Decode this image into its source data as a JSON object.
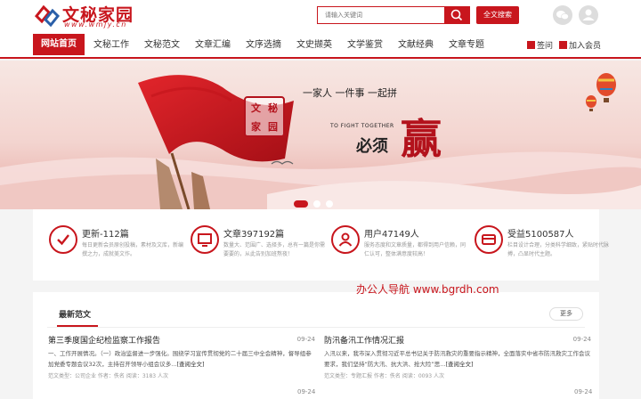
{
  "logo": {
    "title": "文秘家园",
    "subtitle": "www.wmjy.cn"
  },
  "search": {
    "placeholder": "请输入关键词",
    "full_label": "全文搜索"
  },
  "nav": {
    "home": "网站首页",
    "items": [
      "文秘工作",
      "文秘范文",
      "文章汇编",
      "文序选摘",
      "文史撷英",
      "文学鉴赏",
      "文献经典",
      "文章专题"
    ],
    "sign_in": "签问",
    "join": "加入会员"
  },
  "banner": {
    "seal_chars": [
      "文",
      "秘",
      "家",
      "园"
    ],
    "line1": "一家人  一件事  一起拼",
    "line2": "TO FIGHT TOGETHER",
    "line3": "必须",
    "line4": "赢"
  },
  "stats": [
    {
      "title": "更新-112篇",
      "desc": "每日更新会员原创投稿，素材及文库，新编撰之力，成就美文作。"
    },
    {
      "title": "文章397192篇",
      "desc": "数量大、范围广、选择多，总有一篇是你需要要的，从此告别加班熬夜！"
    },
    {
      "title": "用户47149人",
      "desc": "服务态度和文章质量，都得到用户信赖，同仁认可，整体满意度较高！"
    },
    {
      "title": "受益5100587人",
      "desc": "栏目设计合理，分类科学细致，紧贴时代脉搏，凸显时代主题。"
    }
  ],
  "promo": "办公人导航   www.bgrdh.com",
  "latest": {
    "title": "最新范文",
    "more": "更多",
    "articles": [
      {
        "title": "第三季度国企纪检监察工作报告",
        "date": "09-24",
        "summary": "一、工作开展情况。（一）政治监督进一步强化。围绕学习宣传贯彻党的二十届三中全会精神，督导组参加党委专题会议32次，主持召开领导小组会议多...",
        "more": "[查阅全文]",
        "meta": "范文类型：公司企业   作者：佚名   阅读：3183 人次"
      },
      {
        "title": "防汛备汛工作情况汇报",
        "date": "09-24",
        "summary": "入汛以来，我市深入贯彻习近平总书记关于防汛救灾的重要指示精神，全面落实中省市防汛救灾工作会议要求，我们坚持“防大汛、抗大洪、抢大险”思...",
        "more": "[查阅全文]",
        "meta": "范文类型：专题汇报   作者：佚名   阅读：0093 人次"
      }
    ],
    "next_dates": [
      "09-24",
      "09-24"
    ]
  }
}
